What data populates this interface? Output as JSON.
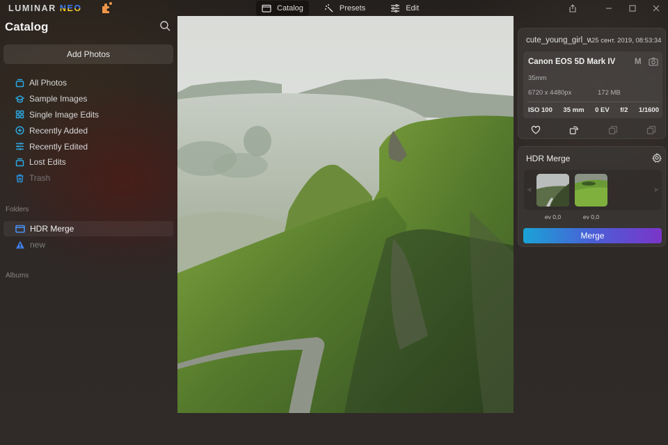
{
  "app": {
    "logo_text": "LUMINAR",
    "logo_accent": "NEO",
    "nav_tabs": [
      {
        "label": "Catalog",
        "icon": "folder-icon",
        "active": true
      },
      {
        "label": "Presets",
        "icon": "magic-wand-icon",
        "active": false
      },
      {
        "label": "Edit",
        "icon": "sliders-icon",
        "active": false
      }
    ],
    "window_controls": [
      "share-icon",
      "minimize-icon",
      "maximize-icon",
      "close-icon"
    ]
  },
  "sidebar": {
    "title": "Catalog",
    "add_photos_label": "Add Photos",
    "items": [
      {
        "label": "All Photos",
        "icon": "photos-stack-icon"
      },
      {
        "label": "Sample Images",
        "icon": "graduation-cap-icon"
      },
      {
        "label": "Single Image Edits",
        "icon": "grid-icon"
      },
      {
        "label": "Recently Added",
        "icon": "plus-circle-icon"
      },
      {
        "label": "Recently Edited",
        "icon": "sliders-icon"
      },
      {
        "label": "Lost Edits",
        "icon": "photos-stack-icon"
      },
      {
        "label": "Trash",
        "icon": "trash-icon"
      }
    ],
    "folders_label": "Folders",
    "folders": [
      {
        "label": "HDR Merge",
        "icon": "folder-icon",
        "selected": true
      },
      {
        "label": "new",
        "icon": "warning-icon",
        "selected": false
      }
    ],
    "albums_label": "Albums"
  },
  "info": {
    "filename": "cute_young_girl_wi",
    "date": "25 сент. 2019, 08:53:34",
    "camera": "Canon EOS 5D Mark IV",
    "mode": "M",
    "lens": "35mm",
    "dimensions": "6720 x 4480px",
    "file_size": "172 MB",
    "exif": {
      "iso": "ISO 100",
      "focal": "35 mm",
      "ev": "0 EV",
      "aperture": "f/2",
      "shutter": "1/1600"
    },
    "actions": [
      "heart-icon",
      "rotate-copy-icon",
      "stack-icon",
      "stack-icon"
    ]
  },
  "hdr": {
    "title": "HDR Merge",
    "thumbs": [
      {
        "ev": "ev 0,0"
      },
      {
        "ev": "ev 0,0"
      }
    ],
    "merge_label": "Merge"
  },
  "colors": {
    "accent_blue": "#2aa7e0",
    "merge_gradient_start": "#1aa3d6",
    "merge_gradient_end": "#7b35c9"
  }
}
